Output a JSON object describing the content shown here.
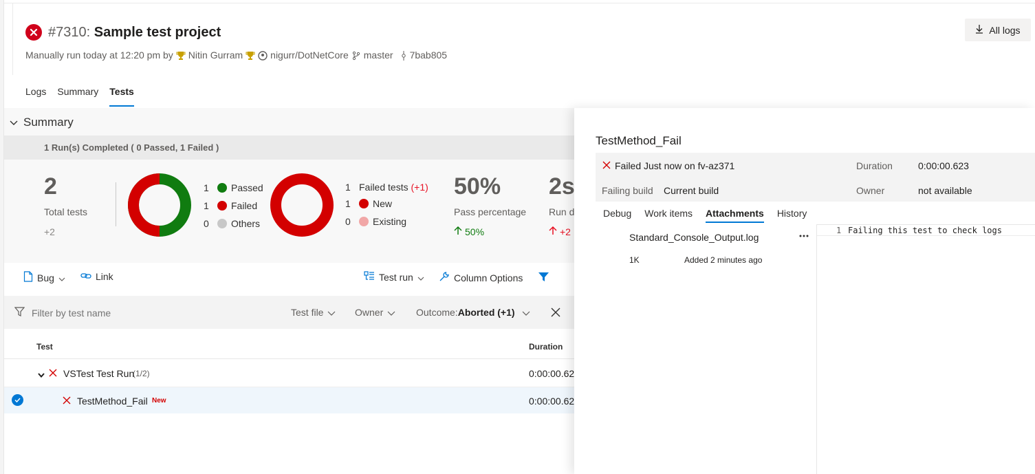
{
  "header": {
    "build_number": "#7310:",
    "title": " Sample test project",
    "meta_prefix": "Manually run today at 12:20 pm by",
    "user": "Nitin Gurram",
    "repo": "nigurr/DotNetCore",
    "branch": "master",
    "commit": "7bab805",
    "all_logs": "All logs"
  },
  "tabs": [
    {
      "label": "Logs"
    },
    {
      "label": "Summary"
    },
    {
      "label": "Tests"
    }
  ],
  "summary": {
    "heading": "Summary",
    "runs_text": "1 Run(s) Completed ( 0 Passed, 1 Failed )",
    "total_value": "2",
    "total_label": "Total tests",
    "total_delta": "+2",
    "outcome_legend": [
      {
        "count": "1",
        "label": "Passed",
        "color": "#107c10"
      },
      {
        "count": "1",
        "label": "Failed",
        "color": "#d30000"
      },
      {
        "count": "0",
        "label": "Others",
        "color": "#c8c8c8"
      }
    ],
    "failed_legend": {
      "count": "1",
      "label": "Failed tests",
      "delta": "(+1)",
      "items": [
        {
          "count": "1",
          "label": "New",
          "color": "#d30000"
        },
        {
          "count": "0",
          "label": "Existing",
          "color": "#f1a7a7"
        }
      ]
    },
    "pass_value": "50%",
    "pass_label": "Pass percentage",
    "pass_delta": "50%",
    "duration_value": "2s",
    "duration_label": "Run d",
    "duration_delta": "+2"
  },
  "toolbar": {
    "bug": "Bug",
    "link": "Link",
    "test_run": "Test run",
    "column_options": "Column Options"
  },
  "filter": {
    "placeholder": "Filter by test name",
    "test_file": "Test file",
    "owner": "Owner",
    "outcome_prefix": "Outcome: ",
    "outcome_value": "Aborted (+1)"
  },
  "grid": {
    "col_test": "Test",
    "col_duration": "Duration",
    "run_name": "VSTest Test Run",
    "run_count": "(1/2)",
    "run_duration": "0:00:00.62",
    "test_name": "TestMethod_Fail",
    "test_badge": "New",
    "test_duration": "0:00:00.62"
  },
  "panel": {
    "title": "TestMethod_Fail",
    "status": "Failed Just now on fv-az371",
    "duration_label": "Duration",
    "duration_value": "0:00:00.623",
    "failing_build_label": "Failing build",
    "failing_build_value": "Current build",
    "owner_label": "Owner",
    "owner_value": "not available",
    "tabs": [
      {
        "label": "Debug"
      },
      {
        "label": "Work items"
      },
      {
        "label": "Attachments"
      },
      {
        "label": "History"
      }
    ],
    "attachment_name": "Standard_Console_Output.log",
    "attachment_size": "1K",
    "attachment_added": "Added 2 minutes ago",
    "code_line_number": "1",
    "code_text": "Failing this test to check logs"
  },
  "colors": {
    "accent": "#0078d4",
    "pass": "#107c10",
    "fail": "#d30000",
    "other": "#c8c8c8",
    "existing": "#f1a7a7"
  }
}
